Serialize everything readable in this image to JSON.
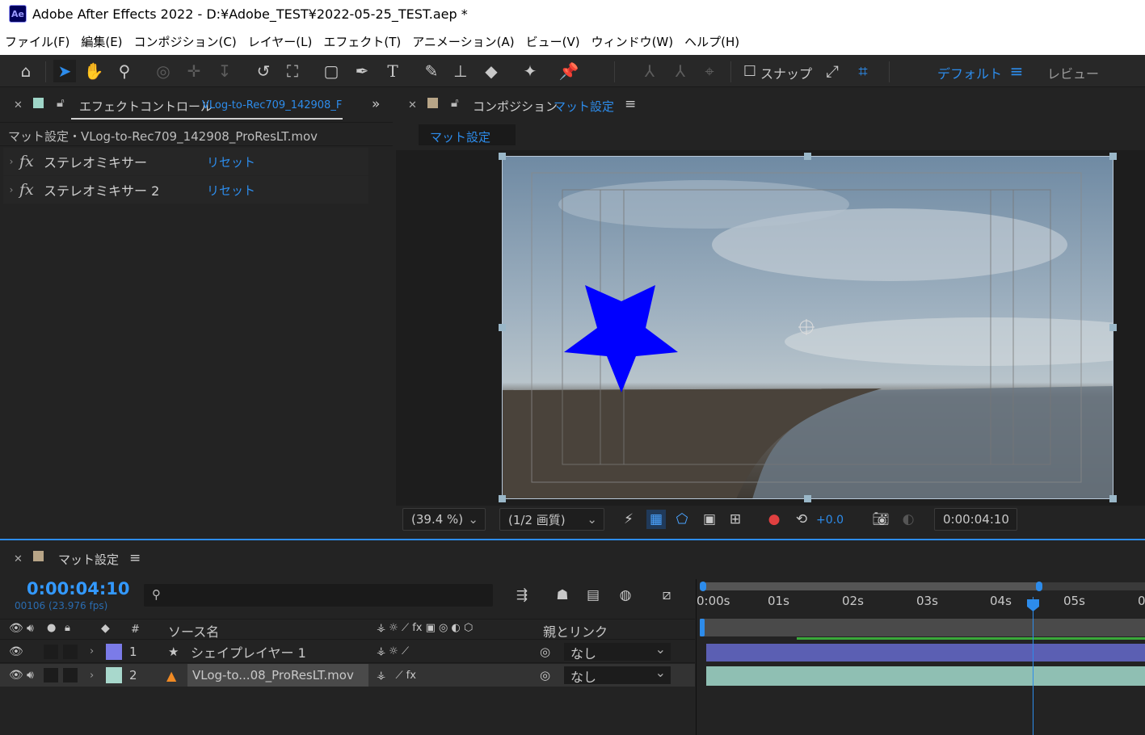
{
  "window": {
    "app_icon": "Ae",
    "title": "Adobe After Effects 2022 - D:¥Adobe_TEST¥2022-05-25_TEST.aep *"
  },
  "menu": [
    "ファイル(F)",
    "編集(E)",
    "コンポジション(C)",
    "レイヤー(L)",
    "エフェクト(T)",
    "アニメーション(A)",
    "ビュー(V)",
    "ウィンドウ(W)",
    "ヘルプ(H)"
  ],
  "toolbar": {
    "snap_label": "スナップ",
    "workspace_default": "デフォルト",
    "workspace_review": "レビュー",
    "icons": [
      "home-icon",
      "selection-tool-icon",
      "hand-tool-icon",
      "zoom-tool-icon",
      "orbit-camera-icon",
      "pan-camera-icon",
      "dolly-camera-icon",
      "rotate-tool-icon",
      "pan-behind-icon",
      "rectangle-tool-icon",
      "pen-tool-icon",
      "type-tool-icon",
      "brush-tool-icon",
      "clone-stamp-icon",
      "eraser-tool-icon",
      "roto-brush-icon",
      "puppet-pin-icon"
    ]
  },
  "effect_controls": {
    "tab_label": "エフェクトコントロール",
    "tab_file": "VLog-to-Rec709_142908_F",
    "subtitle": "マット設定・VLog-to-Rec709_142908_ProResLT.mov",
    "effects": [
      {
        "name": "ステレオミキサー",
        "reset": "リセット"
      },
      {
        "name": "ステレオミキサー 2",
        "reset": "リセット"
      }
    ],
    "colors": {
      "swatch": "#9fd6c8"
    }
  },
  "composition": {
    "tab_prefix": "コンポジション",
    "tab_name": "マット設定",
    "flow_tab": "マット設定",
    "zoom": "(39.4 %)",
    "resolution": "(1/2 画質)",
    "exposure": "+0.0",
    "timecode": "0:00:04:10",
    "colors": {
      "swatch": "#b8a587",
      "star": "#0000ff"
    }
  },
  "timeline": {
    "tab_name": "マット設定",
    "current_time": "0:00:04:10",
    "frame_info": "00106 (23.976 fps)",
    "search_placeholder": "",
    "headers": {
      "num": "#",
      "source": "ソース名",
      "parent": "親とリンク"
    },
    "ruler": [
      "0:00s",
      "01s",
      "02s",
      "03s",
      "04s",
      "05s",
      "0"
    ],
    "layers": [
      {
        "num": "1",
        "name": "シェイプレイヤー 1",
        "parent": "なし",
        "label_color": "#7b7be8",
        "bar_color": "#5b5fb3"
      },
      {
        "num": "2",
        "name": "VLog-to...08_ProResLT.mov",
        "parent": "なし",
        "label_color": "#a8d8cc",
        "bar_color": "#8fbfb3"
      }
    ],
    "colors": {
      "accent": "#2d8ceb",
      "timecode": "#3399ff"
    }
  }
}
